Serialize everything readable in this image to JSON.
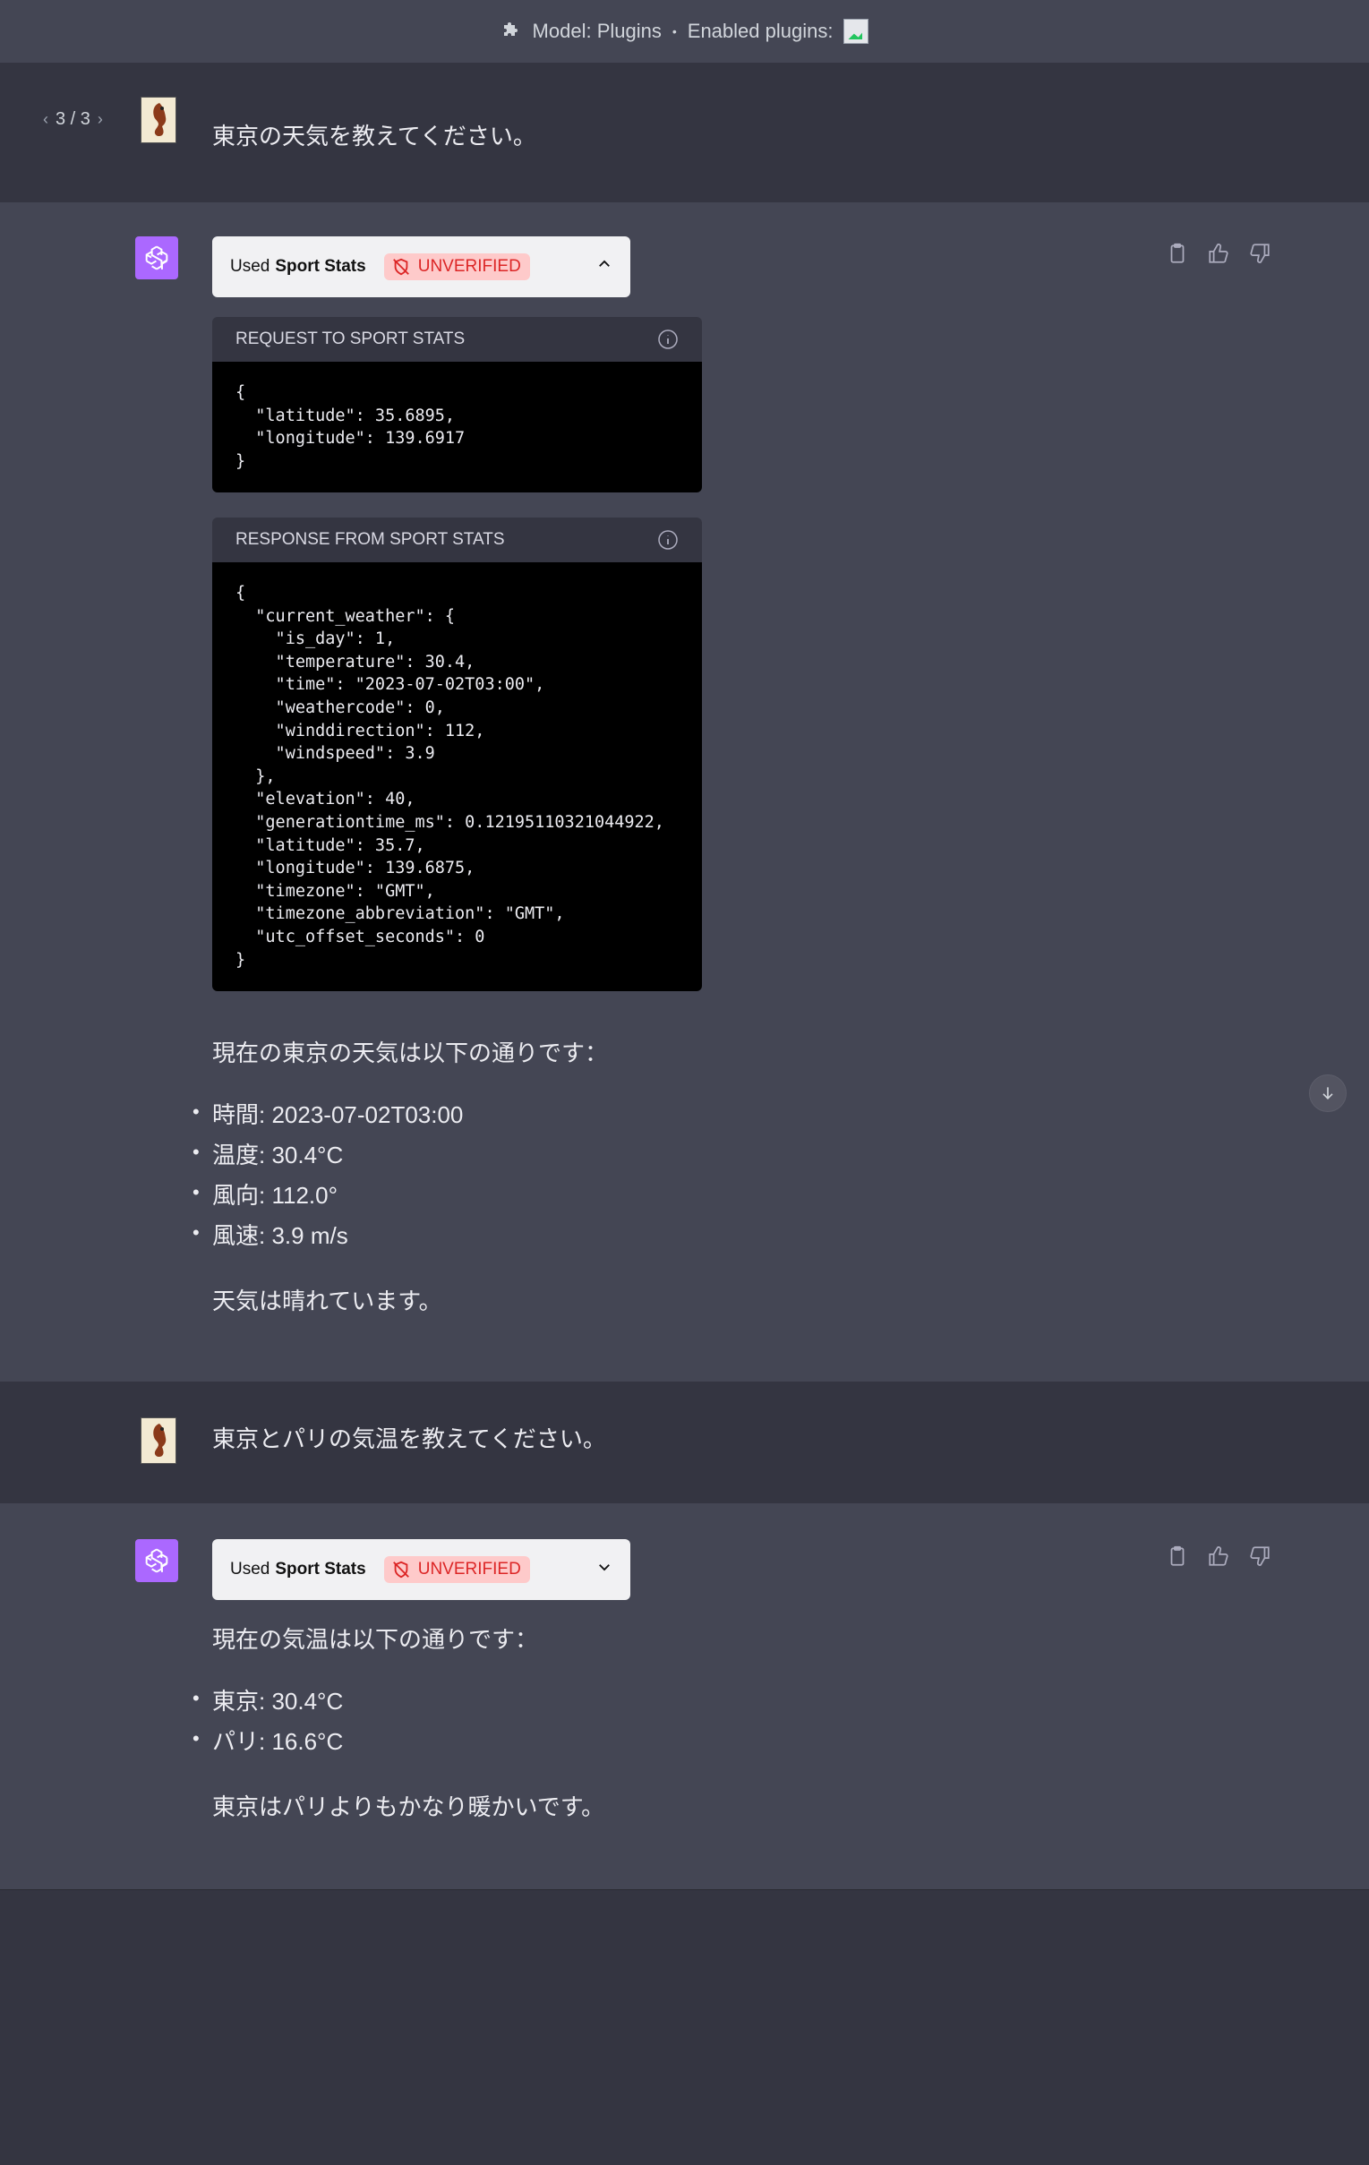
{
  "header": {
    "model_label": "Model: Plugins",
    "separator": "•",
    "enabled_label": "Enabled plugins:"
  },
  "conversation": {
    "pager": {
      "prev": "‹",
      "text": "3 / 3",
      "next": "›"
    },
    "message1_user": "東京の天気を教えてください。",
    "plugin1": {
      "used": "Used",
      "name": "Sport Stats",
      "badge": "UNVERIFIED",
      "toggle": "⌃"
    },
    "request": {
      "title": "REQUEST TO SPORT STATS",
      "code": "{\n  \"latitude\": 35.6895,\n  \"longitude\": 139.6917\n}"
    },
    "response": {
      "title": "RESPONSE FROM SPORT STATS",
      "code": "{\n  \"current_weather\": {\n    \"is_day\": 1,\n    \"temperature\": 30.4,\n    \"time\": \"2023-07-02T03:00\",\n    \"weathercode\": 0,\n    \"winddirection\": 112,\n    \"windspeed\": 3.9\n  },\n  \"elevation\": 40,\n  \"generationtime_ms\": 0.12195110321044922,\n  \"latitude\": 35.7,\n  \"longitude\": 139.6875,\n  \"timezone\": \"GMT\",\n  \"timezone_abbreviation\": \"GMT\",\n  \"utc_offset_seconds\": 0\n}"
    },
    "answer1": {
      "intro": "現在の東京の天気は以下の通りです：",
      "items": [
        "時間: 2023-07-02T03:00",
        "温度: 30.4°C",
        "風向: 112.0°",
        "風速: 3.9 m/s"
      ],
      "outro": "天気は晴れています。"
    },
    "message2_user": "東京とパリの気温を教えてください。",
    "plugin2": {
      "used": "Used",
      "name": "Sport Stats",
      "badge": "UNVERIFIED",
      "toggle": "⌄"
    },
    "answer2": {
      "intro": "現在の気温は以下の通りです：",
      "items": [
        "東京: 30.4°C",
        "パリ: 16.6°C"
      ],
      "outro": "東京はパリよりもかなり暖かいです。"
    }
  }
}
